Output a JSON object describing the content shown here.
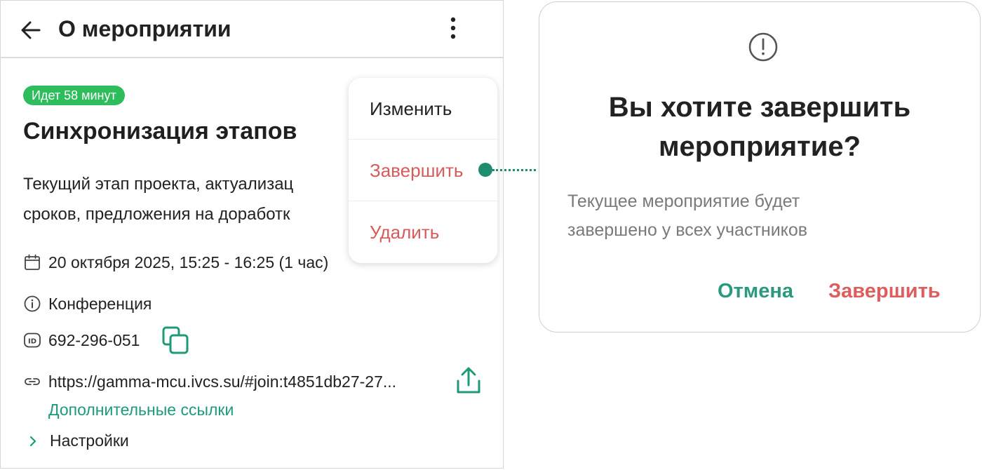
{
  "header": {
    "title": "О мероприятии"
  },
  "event": {
    "status_badge": "Идет 58 минут",
    "title": "Синхронизация этапов",
    "description_lines": [
      "Текущий этап проекта, актуализац",
      "сроков, предложения на доработк"
    ],
    "date": "20 октября 2025, 15:25 - 16:25 (1 час)",
    "type": "Конференция",
    "id": "692-296-051",
    "link": "https://gamma-mcu.ivcs.su/#join:t4851db27-27...",
    "more_links_label": "Дополнительные ссылки",
    "settings_label": "Настройки"
  },
  "menu": {
    "edit": "Изменить",
    "finish": "Завершить",
    "delete": "Удалить"
  },
  "dialog": {
    "title_lines": [
      "Вы хотите завершить",
      "мероприятие?"
    ],
    "body_lines": [
      "Текущее мероприятие будет",
      "завершено у всех участников"
    ],
    "cancel": "Отмена",
    "confirm": "Завершить"
  },
  "icons": {
    "back": "arrow-left-icon",
    "more": "more-vertical-icon",
    "calendar": "calendar-icon",
    "info": "info-icon",
    "id": "id-icon",
    "copy": "copy-icon",
    "link": "link-icon",
    "share": "share-icon",
    "chevron": "chevron-right-icon",
    "alert": "alert-circle-icon"
  },
  "colors": {
    "accent_green": "#1e9a78",
    "status_green": "#2dbd5c",
    "danger_red": "#d65b5b",
    "muted_text": "#7a7a7a"
  }
}
